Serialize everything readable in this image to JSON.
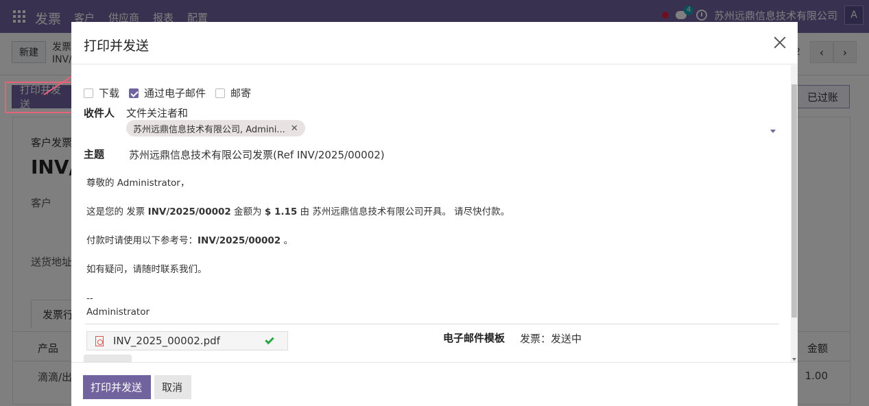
{
  "navbar": {
    "brand": "发票",
    "menu": [
      "客户",
      "供应商",
      "报表",
      "配置"
    ],
    "chat_count": "4",
    "company": "苏州远鼎信息技术有限公司",
    "avatar": "A"
  },
  "control_panel": {
    "new_label": "新建",
    "breadcrumb_line1": "发票",
    "breadcrumb_line2": "INV/",
    "pager_value": "2"
  },
  "statusbar": {
    "print_send_label": "打印并发送",
    "status_posted": "已过账"
  },
  "sheet": {
    "type_label": "客户发票",
    "number_partial": "INV/",
    "customer_label": "客户",
    "shipping_label": "送货地址",
    "tab_lines": "发票行",
    "col_product": "产品",
    "col_amount": "金额",
    "row_product": "滴滴/出",
    "row_amount": "1.00"
  },
  "modal": {
    "title": "打印并发送",
    "options": [
      {
        "label": "下载",
        "checked": false
      },
      {
        "label": "通过电子邮件",
        "checked": true
      },
      {
        "label": "邮寄",
        "checked": false
      }
    ],
    "recipients_label": "收件人",
    "recipients_text": "文件关注者和",
    "recipient_tag": "苏州远鼎信息技术有限公司, Admini...",
    "subject_label": "主题",
    "subject_value": "苏州远鼎信息技术有限公司发票(Ref INV/2025/00002)",
    "body": {
      "greeting": "尊敬的 Administrator，",
      "line2_a": "这是您的 发票 ",
      "line2_invoice": "INV/2025/00002",
      "line2_b": " 金额为 ",
      "line2_amount": "$ 1.15",
      "line2_c": " 由 苏州远鼎信息技术有限公司开具。 请尽快付款。",
      "line3_a": "付款时请使用以下参考号：",
      "line3_ref": "INV/2025/00002",
      "line3_b": " 。",
      "line4": "如有疑问，请随时联系我们。",
      "sig_dash": "--",
      "sig_name": "Administrator"
    },
    "attachment_name": "INV_2025_00002.pdf",
    "template_label": "电子邮件模板",
    "template_value": "发票：发送中",
    "send_button": "打印并发送",
    "cancel_button": "取消"
  }
}
